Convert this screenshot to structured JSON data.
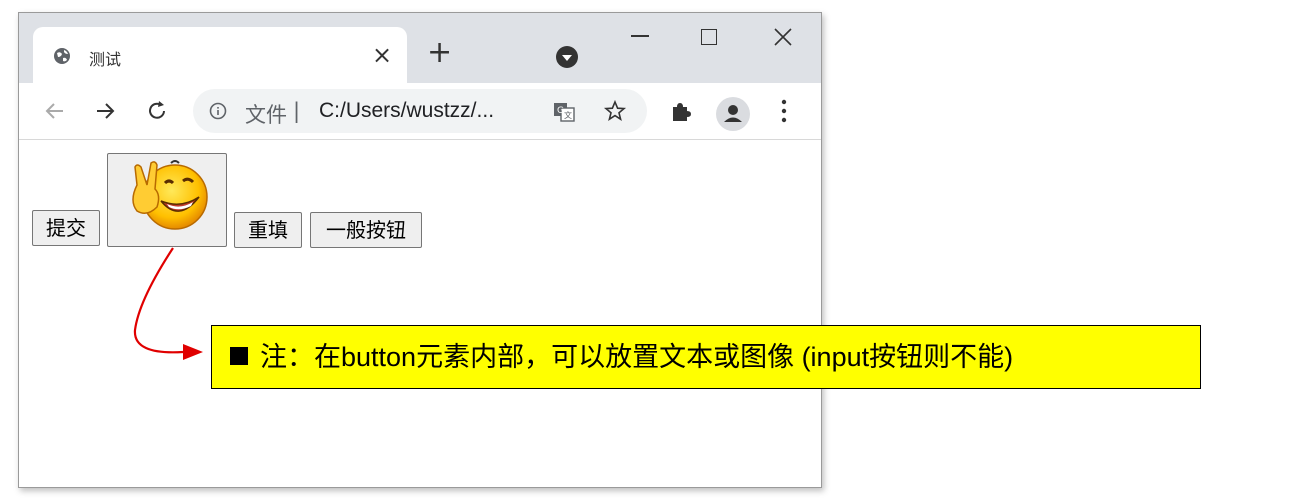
{
  "tab": {
    "title": "测试",
    "close": "×"
  },
  "new_tab": "+",
  "address_bar": {
    "scheme_label": "文件",
    "separator": "|",
    "url": "C:/Users/wustzz/..."
  },
  "buttons": {
    "submit": "提交",
    "reset": "重填",
    "plain": "一般按钮"
  },
  "image_button": {
    "icon": "smiley-victory-emoji"
  },
  "annotation": {
    "text": "注：在button元素内部，可以放置文本或图像 (input按钮则不能)"
  },
  "colors": {
    "note_bg": "#ffff00",
    "arrow": "#e00000",
    "titlebar": "#dee1e6"
  }
}
